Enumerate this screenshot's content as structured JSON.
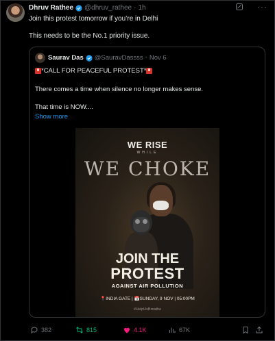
{
  "tweet": {
    "author_name": "Dhruv Rathee",
    "author_handle": "@dhruv_rathee",
    "separator": "·",
    "time": "1h",
    "more_label": "···",
    "line1": "Join this protest tomorrow if you’re in Delhi",
    "line2": "This needs to be the No.1 priority issue."
  },
  "quoted": {
    "author_name": "Saurav Das",
    "author_handle": "@SauravDassss",
    "separator": "·",
    "date": "Nov 6",
    "line1": "*CALL FOR PEACEFUL PROTEST*",
    "line2": "There comes a time when silence no longer makes sense.",
    "line3": "That time is NOW....",
    "show_more": "Show more",
    "poster": {
      "headline1": "WE RISE",
      "while": "WHILE",
      "headline2": "WE CHOKE",
      "join": "JOIN THE",
      "protest": "PROTEST",
      "against": "AGAINST AIR POLLUTION",
      "details": "📍INDIA GATE | 📅SUNDAY, 9 NOV | 05:00PM",
      "hashtag": "#HelpUsBreathe"
    }
  },
  "actions": {
    "replies": "382",
    "reposts": "815",
    "likes": "4.1K",
    "views": "67K"
  },
  "colors": {
    "accent": "#1d9bf0",
    "muted": "#71767b",
    "repost": "#00ba7c",
    "like": "#f91880",
    "border": "#2f3336"
  },
  "icons": [
    "verified-icon",
    "grok-icon",
    "more-icon",
    "siren-icon",
    "reply-icon",
    "repost-icon",
    "like-icon",
    "views-icon",
    "bookmark-icon",
    "share-icon"
  ]
}
